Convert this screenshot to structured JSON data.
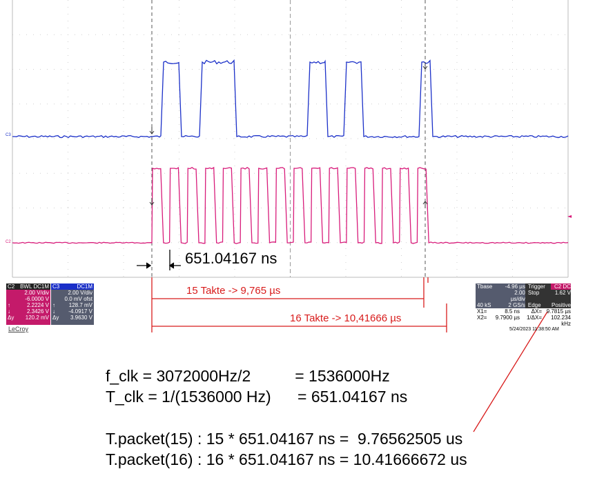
{
  "screen": {
    "ch3_label": "C3",
    "ch2_label": "C2",
    "trigger_marker": "◄"
  },
  "annotations": {
    "period": "651.04167 ns",
    "takte15": "15 Takte -> 9,765 µs",
    "takte16": "16 Takte -> 10,41666 µs",
    "colors": {
      "ch3": "#1a2fc8",
      "ch2": "#d81b7a",
      "annotation": "#d81b1b"
    }
  },
  "channel_c2": {
    "header_left": "C2",
    "header_right": "BWL DC1M",
    "rows": [
      [
        "",
        "2.00 V/div"
      ],
      [
        "",
        "-6.0000 V"
      ],
      [
        "↑",
        "2.2224 V"
      ],
      [
        "↓",
        "2.3426 V"
      ],
      [
        "Δy",
        "120.2 mV"
      ]
    ]
  },
  "channel_c3": {
    "header_left": "C3",
    "header_right": "DC1M",
    "rows": [
      [
        "",
        "2.00 V/div"
      ],
      [
        "",
        "0.0 mV ofst"
      ],
      [
        "↑",
        "128.7 mV"
      ],
      [
        "↓",
        "-4.0917 V"
      ],
      [
        "Δy",
        "3.9630 V"
      ]
    ]
  },
  "brand": "LeCroy",
  "timebase": {
    "header": [
      "Tbase",
      "-4.96 µs",
      "Trigger",
      "C2 DC"
    ],
    "rows": [
      [
        "",
        "2.00 µs/div",
        "Stop",
        "1.62 V"
      ],
      [
        "40 kS",
        "2 GS/s",
        "Edge",
        "Positive"
      ]
    ],
    "cursors": [
      [
        "X1=",
        "8.5 ns",
        "ΔX=",
        "9.7815 µs"
      ],
      [
        "X2=",
        "9.7900 µs",
        "1/ΔX=",
        "102.234 kHz"
      ]
    ],
    "timestamp": "5/24/2023 11:38:50 AM"
  },
  "calculations": [
    "f_clk = 3072000Hz/2          = 1536000Hz",
    "T_clk = 1/(1536000 Hz)      = 651.04167 ns",
    "T.packet(15) : 15 * 651.04167 ns =  9.76562505 us",
    "T.packet(16) : 16 * 651.04167 ns = 10.41666672 us"
  ]
}
